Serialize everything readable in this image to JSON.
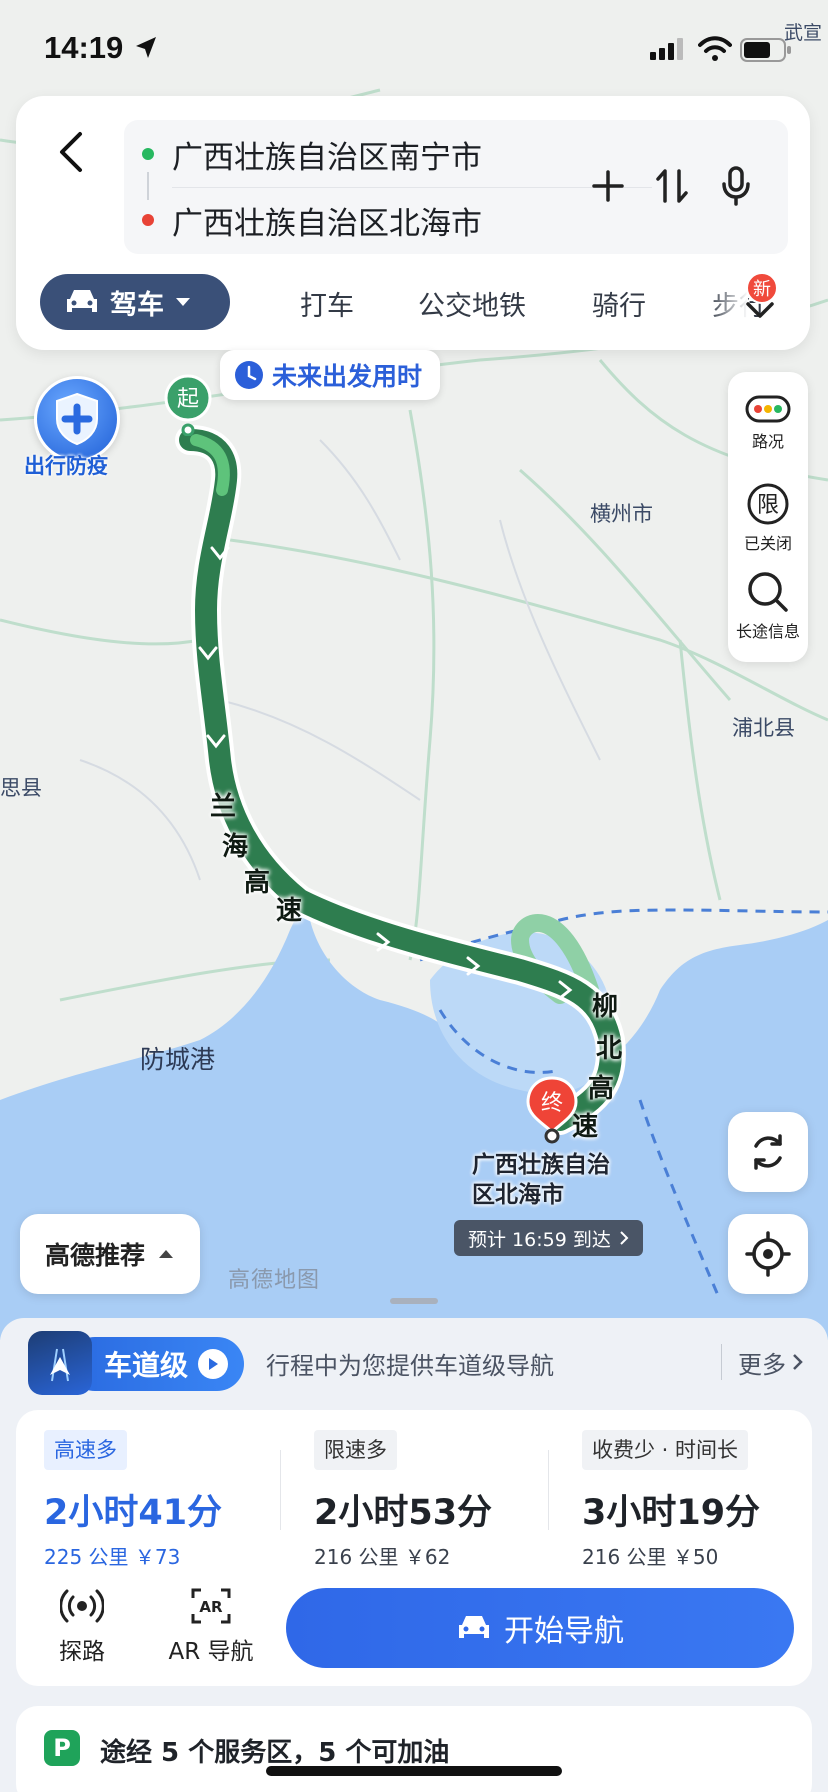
{
  "status_bar": {
    "time": "14:19"
  },
  "search": {
    "from": "广西壮族自治区南宁市",
    "to": "广西壮族自治区北海市"
  },
  "modes": {
    "active": "驾车",
    "items": [
      "打车",
      "公交地铁",
      "骑行",
      "步行"
    ],
    "new_badge": "新"
  },
  "map": {
    "future_departure": "未来出发用时",
    "epidemic_label": "出行防疫",
    "start_pin": "起",
    "end_pin": "终",
    "places": {
      "hengzhou": "横州市",
      "pubei": "浦北县",
      "fangchenggang": "防城港",
      "siyuan": "思县",
      "wuxuan": "武宣"
    },
    "road_names": {
      "a": "兰海高速",
      "b": "柳北高速"
    },
    "destination_label_line1": "广西壮族自治",
    "destination_label_line2": "区北海市",
    "eta": "预计 16:59 到达",
    "watermark": "高德地图",
    "recommend": "高德推荐"
  },
  "side_tools": [
    {
      "label": "路况"
    },
    {
      "label": "已关闭"
    },
    {
      "label": "长途信息"
    }
  ],
  "restriction_glyph": "限",
  "lane_nav": {
    "badge": "车道级",
    "description": "行程中为您提供车道级导航",
    "more": "更多"
  },
  "plans": [
    {
      "tag": "高速多",
      "duration": "2小时41分",
      "distance": "225 公里",
      "cost": "￥73",
      "active": true
    },
    {
      "tag": "限速多",
      "duration": "2小时53分",
      "distance": "216 公里",
      "cost": "￥62",
      "active": false
    },
    {
      "tag": "收费少 · 时间长",
      "duration": "3小时19分",
      "distance": "216 公里",
      "cost": "￥50",
      "active": false
    }
  ],
  "actions": {
    "explore": "探路",
    "ar_nav": "AR 导航",
    "start_nav": "开始导航"
  },
  "service": {
    "icon": "P",
    "text": "途经 5 个服务区，5 个可加油"
  },
  "colors": {
    "route_green": "#2e7d4f",
    "route_light": "#8fd0a6",
    "accent_blue": "#2f68e8",
    "sea": "#a9cdf5"
  }
}
